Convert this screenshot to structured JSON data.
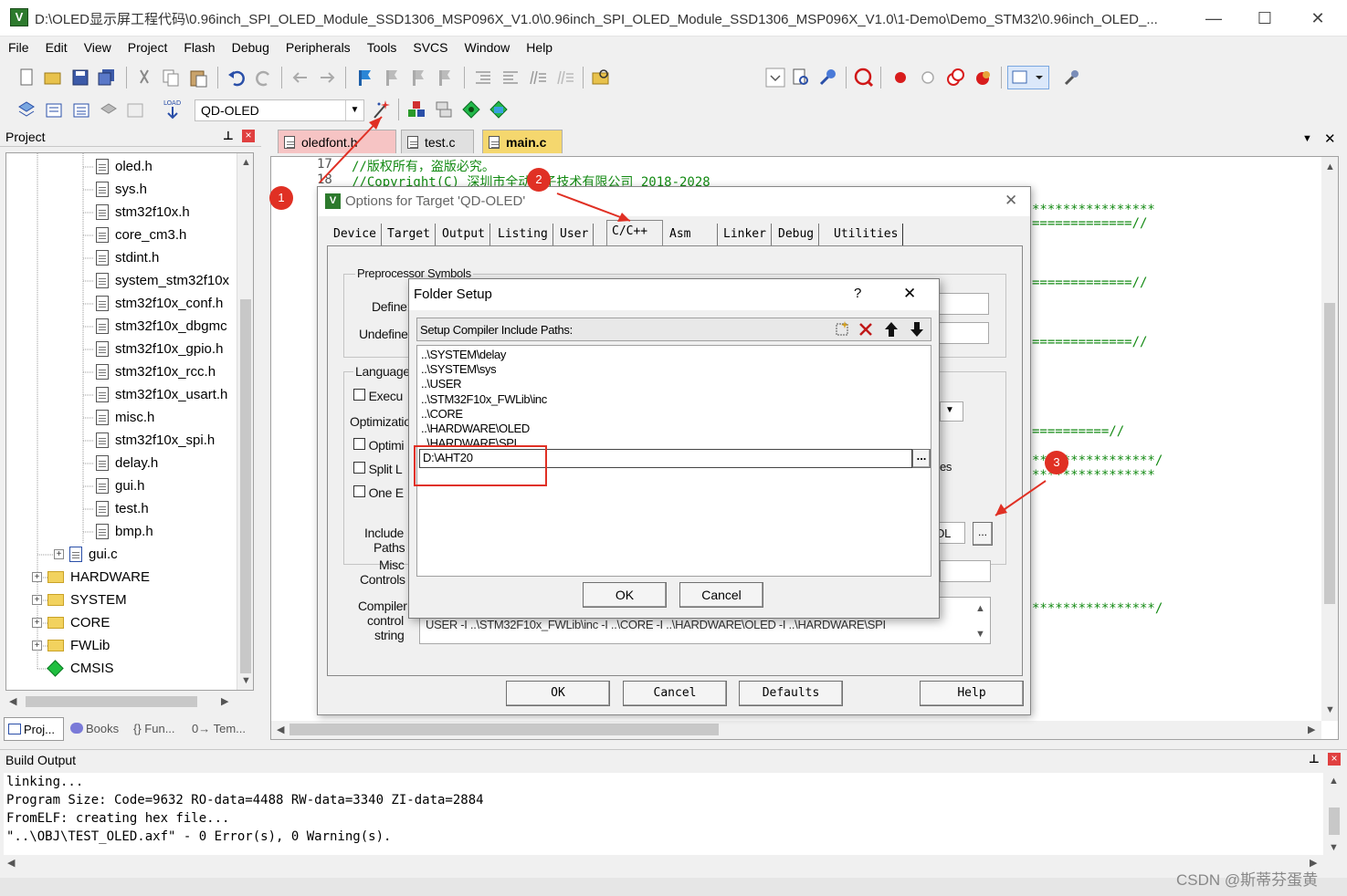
{
  "window": {
    "title": "D:\\OLED显示屏工程代码\\0.96inch_SPI_OLED_Module_SSD1306_MSP096X_V1.0\\0.96inch_SPI_OLED_Module_SSD1306_MSP096X_V1.0\\1-Demo\\Demo_STM32\\0.96inch_OLED_...",
    "minimize": "—",
    "maximize": "☐",
    "close": "✕"
  },
  "menu": [
    "File",
    "Edit",
    "View",
    "Project",
    "Flash",
    "Debug",
    "Peripherals",
    "Tools",
    "SVCS",
    "Window",
    "Help"
  ],
  "build_toolbar": {
    "target": "QD-OLED"
  },
  "project_panel": {
    "title": "Project",
    "pin": "ᵖ",
    "close": "×",
    "files": [
      "oled.h",
      "sys.h",
      "stm32f10x.h",
      "core_cm3.h",
      "stdint.h",
      "system_stm32f10x",
      "stm32f10x_conf.h",
      "stm32f10x_dbgmc",
      "stm32f10x_gpio.h",
      "stm32f10x_rcc.h",
      "stm32f10x_usart.h",
      "misc.h",
      "stm32f10x_spi.h",
      "delay.h",
      "gui.h",
      "test.h",
      "bmp.h"
    ],
    "source_file": "gui.c",
    "groups": [
      "HARDWARE",
      "SYSTEM",
      "CORE",
      "FWLib"
    ],
    "cmsis": "CMSIS",
    "bottom_tabs": [
      "Proj...",
      "Books",
      "{} Fun...",
      "0→ Tem..."
    ]
  },
  "editor": {
    "tabs": [
      "oledfont.h",
      "test.c",
      "main.c"
    ],
    "active_tab": "main.c",
    "line_numbers": [
      "17",
      "18"
    ],
    "lines": [
      "//版权所有，盗版必究。",
      "//Copyright(C) 深圳市全动电子技术有限公司 2018-2028"
    ],
    "right_fragments": [
      "****************",
      "=============//",
      "=============//",
      "=============//",
      "==========//",
      "****************/",
      "****************",
      "****************/"
    ]
  },
  "options_dialog": {
    "title": "Options for Target 'QD-OLED'",
    "tabs": [
      "Device",
      "Target",
      "Output",
      "Listing",
      "User",
      "C/C++",
      "Asm",
      "Linker",
      "Debug",
      "Utilities"
    ],
    "active_tab": "C/C++",
    "preprocessor_group": "Preprocessor Symbols",
    "define_label": "Define:",
    "undefine_label": "Undefine:",
    "language_group": "Language",
    "execute_label": "Execu",
    "optimization_label": "Optimizatio",
    "optimize_label": "Optimi",
    "split_label": "Split L",
    "one_label": "One E",
    "include_paths_label_1": "Include",
    "include_paths_label_2": "Paths",
    "misc_label_1": "Misc",
    "misc_label_2": "Controls",
    "compiler_label_1": "Compiler",
    "compiler_label_2": "control",
    "compiler_label_3": "string",
    "include_fragment": "\\OL",
    "es_fragment": "es",
    "compiler_string": "USER -I ..\\STM32F10x_FWLib\\inc -I ..\\CORE -I ..\\HARDWARE\\OLED -I ..\\HARDWARE\\SPI",
    "browse": "...",
    "buttons": [
      "OK",
      "Cancel",
      "Defaults",
      "Help"
    ]
  },
  "folder_dialog": {
    "title": "Folder Setup",
    "help": "?",
    "close": "✕",
    "header": "Setup Compiler Include Paths:",
    "paths": [
      "..\\SYSTEM\\delay",
      "..\\SYSTEM\\sys",
      "..\\USER",
      "..\\STM32F10x_FWLib\\inc",
      "..\\CORE",
      "..\\HARDWARE\\OLED",
      "..\\HARDWARE\\SPI"
    ],
    "editing_value": "D:\\AHT20",
    "browse": "...",
    "ok": "OK",
    "cancel": "Cancel"
  },
  "annotations": [
    "1",
    "2",
    "3"
  ],
  "build_output": {
    "title": "Build Output",
    "lines": [
      "linking...",
      "Program Size: Code=9632 RO-data=4488 RW-data=3340 ZI-data=2884",
      "FromELF: creating hex file...",
      "\"..\\OBJ\\TEST_OLED.axf\" - 0 Error(s), 0 Warning(s)."
    ]
  },
  "watermark": "CSDN @斯蒂芬蛋黄",
  "colors": {
    "annotation": "#e03024",
    "active_tab": "#f5d76e",
    "file_tab": "#f8c8c8",
    "comment": "#138a13"
  }
}
